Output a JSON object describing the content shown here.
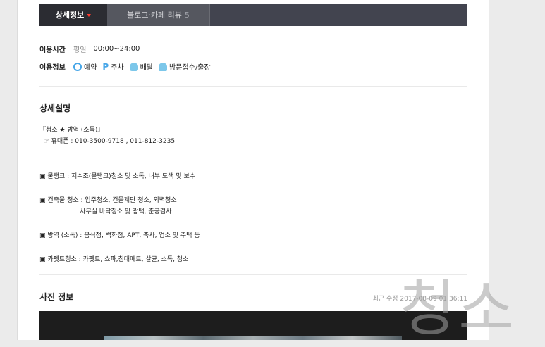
{
  "tabs": [
    {
      "label": "상세정보",
      "active": true
    },
    {
      "label": "블로그·카페 리뷰",
      "count": "5",
      "active": false
    }
  ],
  "hours": {
    "label": "이용시간",
    "day": "평일",
    "time": "00:00~24:00"
  },
  "services": {
    "label": "이용정보",
    "items": [
      {
        "icon": "clock-icon",
        "label": "예약"
      },
      {
        "icon": "parking-icon",
        "label": "주차"
      },
      {
        "icon": "delivery-icon",
        "label": "배달"
      },
      {
        "icon": "person-icon",
        "label": "방문접수/출장"
      }
    ]
  },
  "detail": {
    "title": "상세설명",
    "lines": [
      "『청소 ★ 방역 (소독)』",
      "  ☞ 휴대폰 : 010-3500-9718 , 011-812-3235",
      "▣ 물탱크 : 저수조(물탱크)청소 및 소독, 내부 도색 및 보수",
      "▣ 건축물 청소 : 입주청소, 건물계단 청소, 외벽청소",
      "                    사무실 바닥청소 및 광택, 준공검사",
      "▣ 방역 (소독) : 음식점, 백화점, APT, 축사, 업소 및 주택 등",
      "▣ 카펫트청소 : 카펫트, 쇼파,침대매트, 살균, 소독, 청소"
    ]
  },
  "photos": {
    "title": "사진 정보",
    "updated": "최근 수정 2017-08-09 01:36:11"
  },
  "watermark": "청소"
}
